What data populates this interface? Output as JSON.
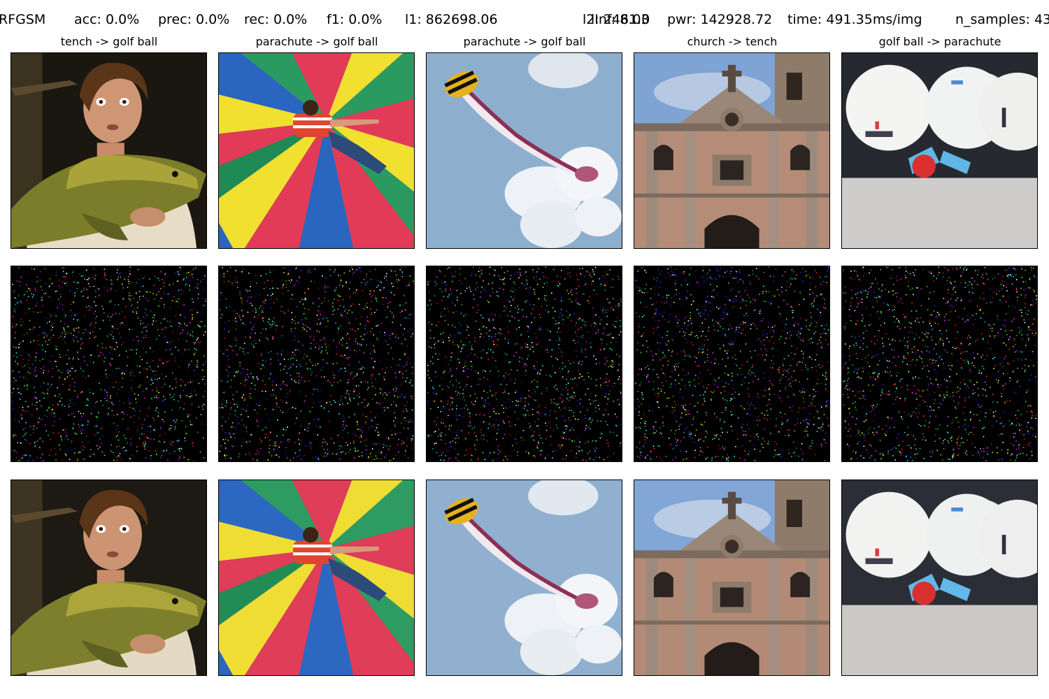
{
  "header": {
    "attack": "RFGSM",
    "acc": "acc: 0.0%",
    "prec": "prec: 0.0%",
    "rec": "rec: 0.0%",
    "f1": "f1: 0.0%",
    "l1": "l1: 862698.06",
    "l2": "l2: 2461.0",
    "linf": "lInf: 8.03",
    "pwr": "pwr: 142928.72",
    "time": "time: 491.35ms/img",
    "n_samples": "n_samples: 43"
  },
  "columns": [
    {
      "title": "tench -> golf ball",
      "image": "man holding a large tench fish at night"
    },
    {
      "title": "parachute -> golf ball",
      "image": "person lying on a multicolored parachute canopy"
    },
    {
      "title": "parachute -> golf ball",
      "image": "yellow-black parachute trailing red smoke in blue sky"
    },
    {
      "title": "church -> tench",
      "image": "facade of a colonial stone church with bell tower"
    },
    {
      "title": "golf ball -> parachute",
      "image": "three white golf balls with blue and red tees"
    }
  ],
  "colors": {
    "background": "#ffffff",
    "perturbation_bg": "#000000",
    "noise_palette": [
      "#ff2020",
      "#20ff20",
      "#3030ff",
      "#ff20ff",
      "#20ffff",
      "#ffff20",
      "#ffffff"
    ]
  }
}
